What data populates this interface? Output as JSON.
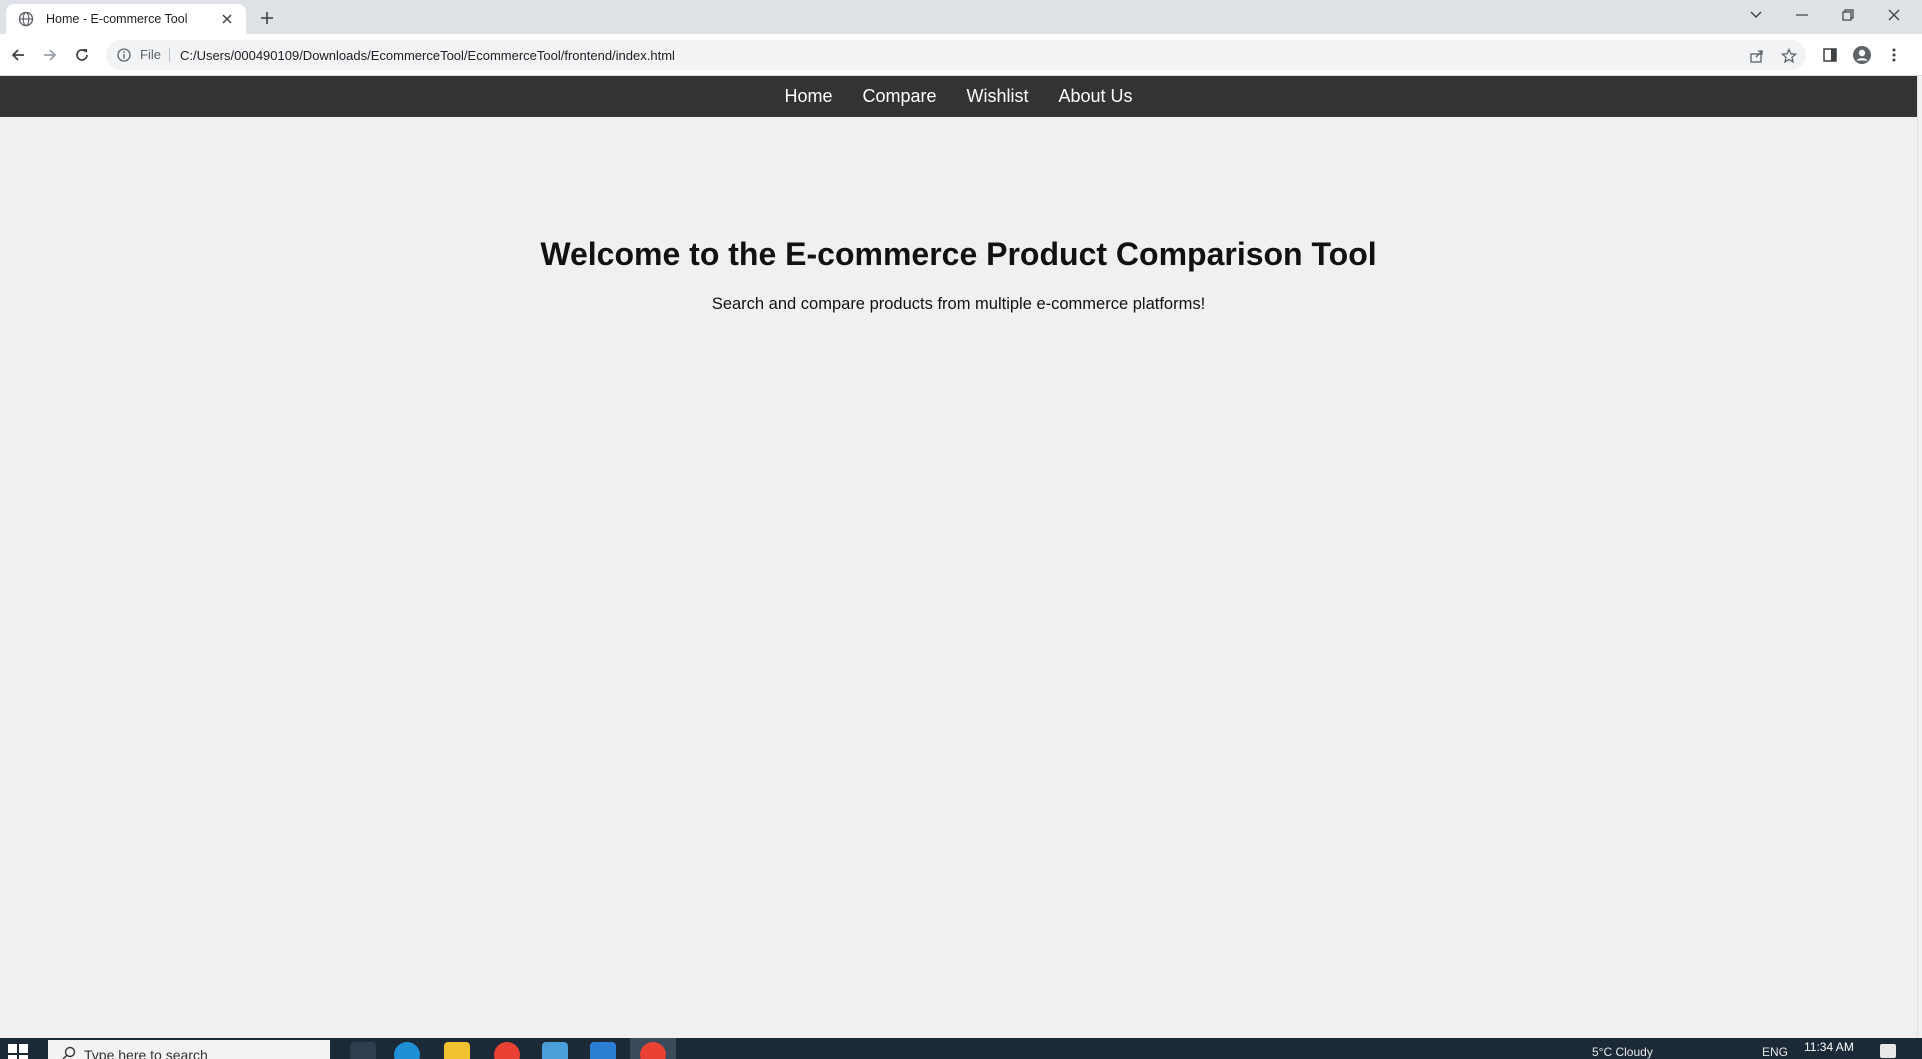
{
  "browser": {
    "tab_title": "Home - E-commerce Tool",
    "address_scheme": "File",
    "address_url": "C:/Users/000490109/Downloads/EcommerceTool/EcommerceTool/frontend/index.html"
  },
  "page": {
    "nav_items": [
      "Home",
      "Compare",
      "Wishlist",
      "About Us"
    ],
    "hero_title": "Welcome to the E-commerce Product Comparison Tool",
    "hero_subtitle": "Search and compare products from multiple e-commerce platforms!",
    "nav_background": "#333333",
    "page_background": "#f0f0f0"
  },
  "taskbar": {
    "search_placeholder": "Type here to search",
    "weather": "5°C  Cloudy",
    "language": "ENG",
    "clock_time": "11:34 AM"
  }
}
